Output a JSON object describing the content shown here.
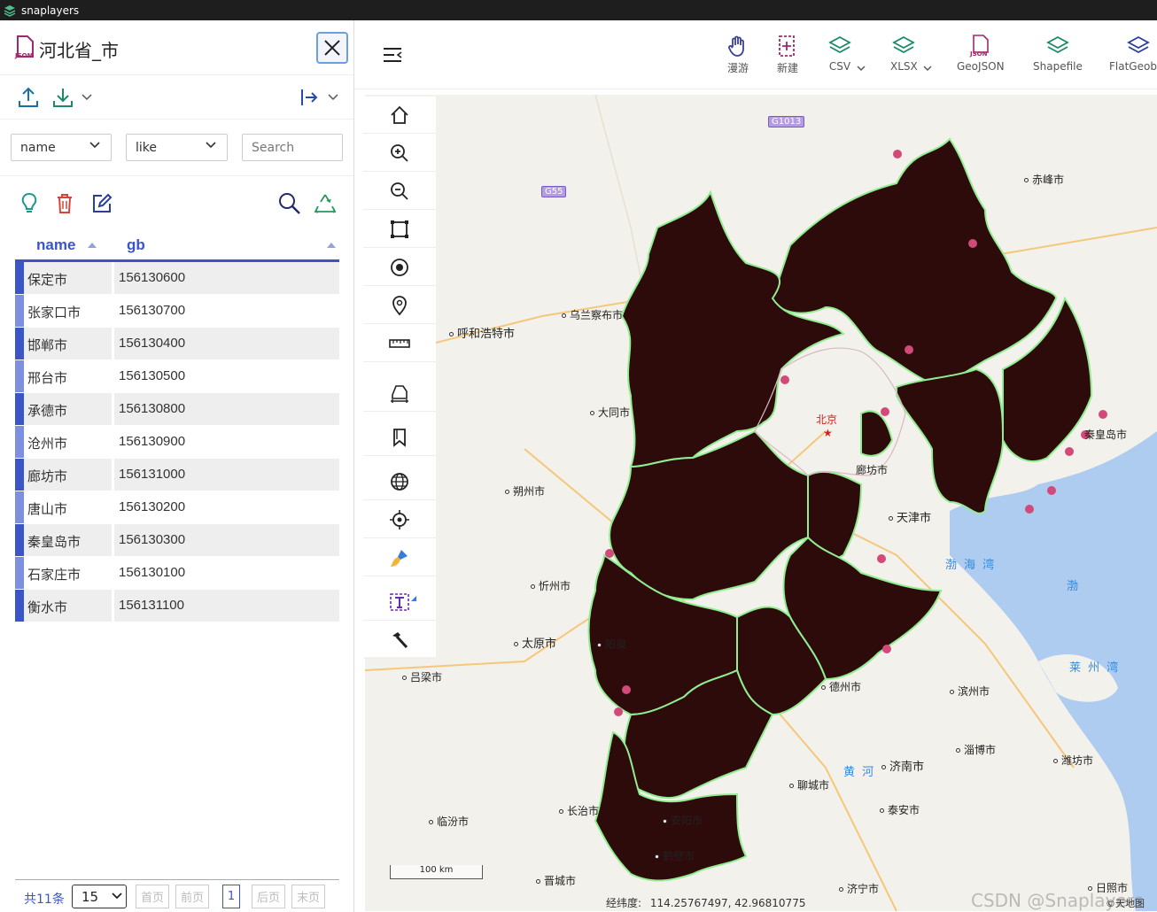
{
  "app": {
    "title": "snaplayers"
  },
  "panel": {
    "title": "河北省_市",
    "filter": {
      "field": "name",
      "operator": "like",
      "search_placeholder": "Search"
    },
    "table": {
      "columns": [
        "name",
        "gb"
      ],
      "rows": [
        {
          "name": "保定市",
          "gb": "156130600"
        },
        {
          "name": "张家口市",
          "gb": "156130700"
        },
        {
          "name": "邯郸市",
          "gb": "156130400"
        },
        {
          "name": "邢台市",
          "gb": "156130500"
        },
        {
          "name": "承德市",
          "gb": "156130800"
        },
        {
          "name": "沧州市",
          "gb": "156130900"
        },
        {
          "name": "廊坊市",
          "gb": "156131000"
        },
        {
          "name": "唐山市",
          "gb": "156130200"
        },
        {
          "name": "秦皇岛市",
          "gb": "156130300"
        },
        {
          "name": "石家庄市",
          "gb": "156130100"
        },
        {
          "name": "衡水市",
          "gb": "156131100"
        }
      ]
    },
    "pager": {
      "total": "共11条",
      "page_size": "15",
      "first": "首页",
      "prev": "前页",
      "current": "1",
      "next": "后页",
      "last": "末页"
    }
  },
  "toolbar": {
    "items": [
      {
        "label": "漫游",
        "icon": "hand-icon"
      },
      {
        "label": "新建",
        "icon": "new-file-icon"
      },
      {
        "label": "CSV",
        "icon": "layers-icon"
      },
      {
        "label": "XLSX",
        "icon": "layers-icon"
      },
      {
        "label": "GeoJSON",
        "icon": "json-file-icon"
      },
      {
        "label": "Shapefile",
        "icon": "layers-icon"
      },
      {
        "label": "FlatGeobuf",
        "icon": "layers-icon"
      }
    ]
  },
  "map": {
    "labels": [
      {
        "text": "G1013"
      },
      {
        "text": "G55"
      },
      {
        "text": "赤峰市"
      },
      {
        "text": "乌兰察布市"
      },
      {
        "text": "呼和浩特市"
      },
      {
        "text": "大同市"
      },
      {
        "text": "北京"
      },
      {
        "text": "廊坊市"
      },
      {
        "text": "天津市"
      },
      {
        "text": "秦皇岛市"
      },
      {
        "text": "朔州市"
      },
      {
        "text": "忻州市"
      },
      {
        "text": "太原市"
      },
      {
        "text": "阳泉"
      },
      {
        "text": "吕梁市"
      },
      {
        "text": "德州市"
      },
      {
        "text": "滨州市"
      },
      {
        "text": "淄博市"
      },
      {
        "text": "潍坊市"
      },
      {
        "text": "济南市"
      },
      {
        "text": "聊城市"
      },
      {
        "text": "泰安市"
      },
      {
        "text": "长治市"
      },
      {
        "text": "临汾市"
      },
      {
        "text": "安阳市"
      },
      {
        "text": "鹤壁市"
      },
      {
        "text": "晋城市"
      },
      {
        "text": "济宁市"
      },
      {
        "text": "日照市"
      },
      {
        "text": "渤 海 湾"
      },
      {
        "text": "渤"
      },
      {
        "text": "莱 州 湾"
      },
      {
        "text": "黄 河"
      }
    ],
    "scale": "100 km",
    "coords_label": "经纬度:",
    "coords_value": "114.25767497, 42.96810775",
    "attribution": "©天地图",
    "watermark": "CSDN @Snaplayers",
    "colors": {
      "fill": "#2e0b0b",
      "outline": "#90ee90",
      "sea": "#aecbf0",
      "land": "#f3f1ec"
    }
  }
}
